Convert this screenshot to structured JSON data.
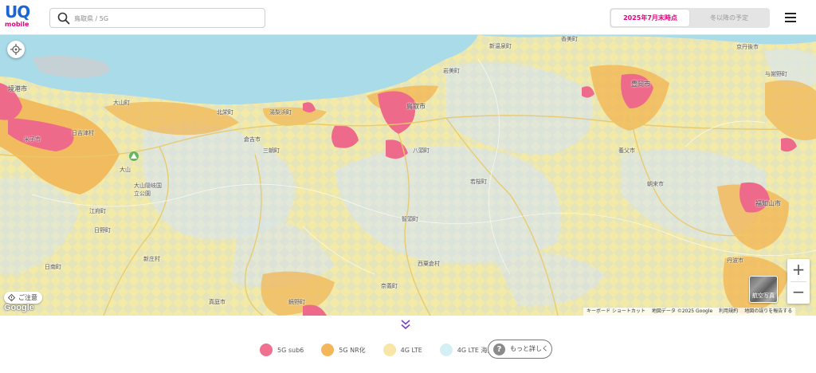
{
  "header": {
    "logo": {
      "main": "UQ",
      "sub": "mobile"
    },
    "search": {
      "placeholder": "鳥取県 / 5G"
    },
    "tabs": [
      {
        "label": "2025年7月末時点",
        "active": true
      },
      {
        "label": "冬以降の予定",
        "active": false
      }
    ],
    "menu_icon": "hamburger-menu-icon"
  },
  "map": {
    "controls": {
      "locate_icon": "crosshair-location-icon",
      "zoom_in": "+",
      "zoom_out": "−",
      "aerial_label": "航空写真",
      "attention_label": "ご注意",
      "google_logo": "Google"
    },
    "attribution": [
      "キーボード ショートカット",
      "地図データ ©2025 Google",
      "利用規約",
      "地図の誤りを報告する"
    ],
    "place_labels": [
      {
        "text": "境港市"
      },
      {
        "text": "日吉津村"
      },
      {
        "text": "大山町"
      },
      {
        "text": "北栄町"
      },
      {
        "text": "湯梨浜町"
      },
      {
        "text": "鳥取市"
      },
      {
        "text": "岩美町"
      },
      {
        "text": "新温泉町"
      },
      {
        "text": "香美町"
      },
      {
        "text": "豊岡市"
      },
      {
        "text": "倉吉市"
      },
      {
        "text": "三朝町"
      },
      {
        "text": "八頭町"
      },
      {
        "text": "若桜町"
      },
      {
        "text": "養父市"
      },
      {
        "text": "朝来市"
      },
      {
        "text": "福知山市"
      },
      {
        "text": "智頭町"
      },
      {
        "text": "大山隠岐国立公園"
      },
      {
        "text": "大山"
      },
      {
        "text": "江府町"
      },
      {
        "text": "日野町"
      },
      {
        "text": "日南町"
      },
      {
        "text": "新庄村"
      },
      {
        "text": "西粟倉村"
      },
      {
        "text": "奈義町"
      },
      {
        "text": "鏡野町"
      },
      {
        "text": "真庭市"
      },
      {
        "text": "丹波市"
      },
      {
        "text": "京丹後市"
      },
      {
        "text": "与謝野町"
      },
      {
        "text": "米子市"
      }
    ],
    "colors": {
      "sea": "#a9dbe9",
      "land_4g": "#f3eaa8",
      "mountain": "#dde6e4",
      "nr_5g": "#f2b755",
      "sub6_5g": "#ee6a8a"
    }
  },
  "legend": {
    "items": [
      {
        "label": "5G sub6",
        "color": "#f07090"
      },
      {
        "label": "5G NR化",
        "color": "#f5b55a"
      },
      {
        "label": "4G LTE",
        "color": "#f7e6a8"
      },
      {
        "label": "4G LTE 海上エリア",
        "color": "#d4f0f5"
      }
    ],
    "more_label": "もっと詳しく",
    "more_icon": "question-icon",
    "expand_icon": "double-chevron-down-icon"
  }
}
